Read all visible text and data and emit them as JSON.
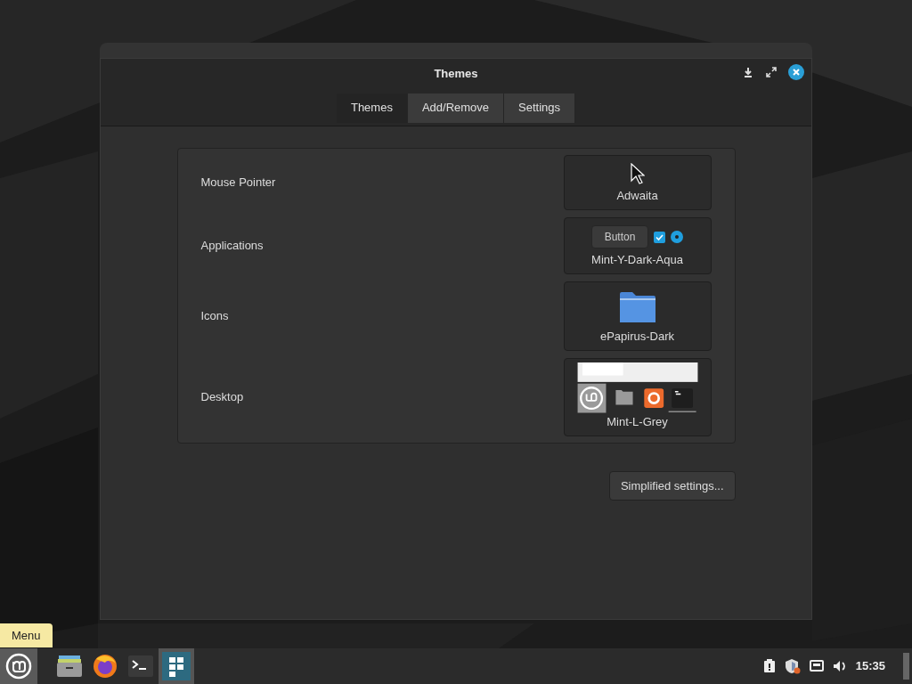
{
  "window": {
    "title": "Themes"
  },
  "tabs": [
    {
      "label": "Themes",
      "selected": true
    },
    {
      "label": "Add/Remove",
      "selected": false
    },
    {
      "label": "Settings",
      "selected": false
    }
  ],
  "theme_rows": [
    {
      "label": "Mouse Pointer",
      "kind": "pointer",
      "theme": "Adwaita"
    },
    {
      "label": "Applications",
      "kind": "applications",
      "theme": "Mint-Y-Dark-Aqua",
      "sample_button": "Button"
    },
    {
      "label": "Icons",
      "kind": "icons",
      "theme": "ePapirus-Dark"
    },
    {
      "label": "Desktop",
      "kind": "desktop",
      "theme": "Mint-L-Grey"
    }
  ],
  "simplified_button": "Simplified settings...",
  "tooltip": "Menu",
  "taskbar": {
    "launchers": [
      {
        "kind": "files",
        "selected": false
      },
      {
        "kind": "browser",
        "selected": false
      },
      {
        "kind": "terminal",
        "selected": false
      },
      {
        "kind": "themes",
        "selected": true
      }
    ],
    "clock": "15:35"
  }
}
